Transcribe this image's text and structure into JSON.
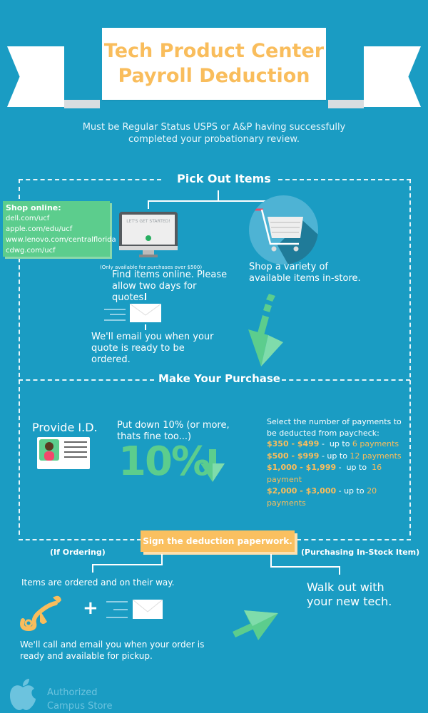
{
  "header": {
    "title_line1": "Tech Product Center",
    "title_line2": "Payroll Deduction",
    "subtitle": "Must be Regular Status USPS or A&P having successfully completed your probationary review."
  },
  "colors": {
    "background": "#1a9cc3",
    "accent_gold": "#f9bd5c",
    "accent_green": "#5ccd8d",
    "white": "#ffffff"
  },
  "pick_out": {
    "title": "Pick Out Items",
    "shop_online": {
      "heading": "Shop online:",
      "links": [
        "dell.com/ucf",
        "apple.com/edu/ucf",
        "www.lenovo.com/centralflorida",
        "cdwg.com/ucf"
      ]
    },
    "monitor_screen_text": "LET'S GET STARTED!",
    "online_note": "(Only available for purchases over $500)",
    "online_text": "Find items online.  Please allow two days for quotes.",
    "email_text": "We'll email you when your quote is ready to be ordered.",
    "instore_text": "Shop a variety of available items in-store."
  },
  "purchase": {
    "title": "Make Your Purchase",
    "provide_id": "Provide I.D.",
    "down_payment_text": "Put down 10% (or more, thats fine too...)",
    "percent": "10%",
    "payments_intro": "Select the number of payments to be deducted from paycheck:",
    "tiers": [
      {
        "range": "$350 - $499",
        "sep": " -  up to ",
        "payments": "6 payments"
      },
      {
        "range": "$500 - $999",
        "sep": " - up to ",
        "payments": "12 payments"
      },
      {
        "range": "$1,000 - $1,999",
        "sep": " -  up to  ",
        "payments": "16 payment"
      },
      {
        "range": "$2,000 - $3,000",
        "sep": " - up to ",
        "payments": "20 payments"
      }
    ]
  },
  "sign": {
    "label": "Sign the deduction paperwork.",
    "left_branch": "(If Ordering)",
    "right_branch": "(Purchasing In-Stock Item)",
    "ordered_text": "Items are ordered and on their way.",
    "plus": "+",
    "notify_text": "We'll call and email you when your order is ready and available for pickup.",
    "walkout_text": "Walk out with your new tech."
  },
  "footer": {
    "line1": "Authorized",
    "line2": "Campus Store"
  }
}
